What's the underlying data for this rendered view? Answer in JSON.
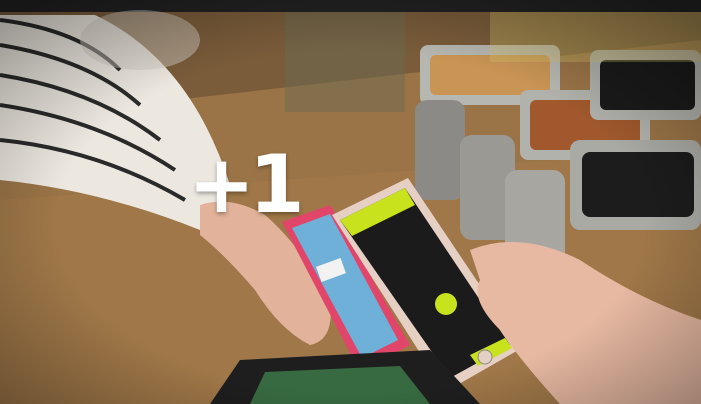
{
  "overlay": {
    "text": "+1"
  },
  "colors": {
    "table": "#8a6a45",
    "sleeve_stripe": "#2a2a2a",
    "sleeve_base": "#e9e5dc",
    "phone_accent": "#c8e21d",
    "phone_case_pink": "#e2456a"
  }
}
